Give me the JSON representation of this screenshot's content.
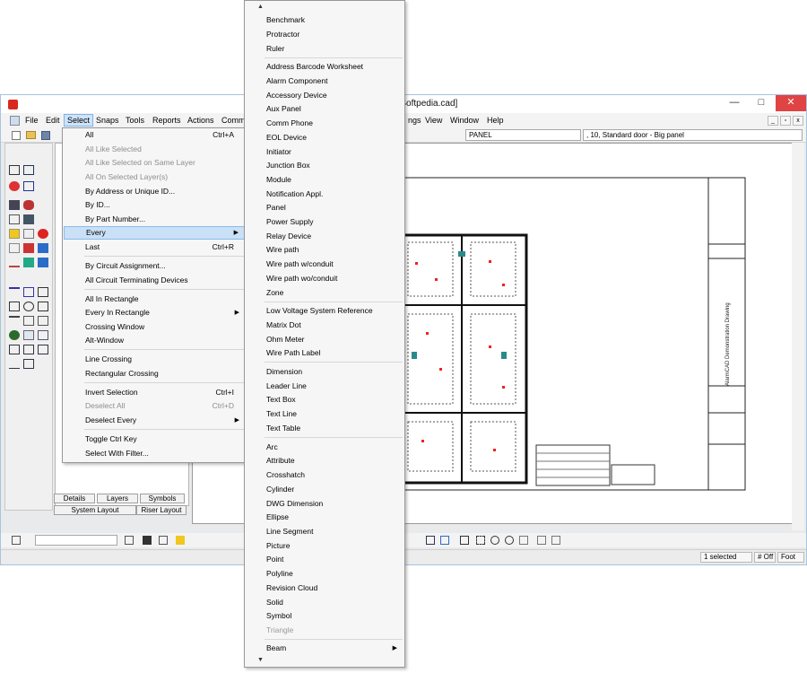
{
  "window": {
    "title": "c - [Softpedia.cad]",
    "minimize": "—",
    "maximize": "□",
    "close": "✕"
  },
  "menubar": {
    "file": "File",
    "edit": "Edit",
    "select": "Select",
    "snaps": "Snaps",
    "tools": "Tools",
    "reports": "Reports",
    "actions": "Actions",
    "comm": "Comm",
    "settings_partial": "ngs",
    "view": "View",
    "window": "Window",
    "help": "Help"
  },
  "toolbar": {
    "layer_combo": "PANEL",
    "block_combo": ", 10, Standard door - Big panel"
  },
  "left_panel": {
    "tabs": [
      "Details",
      "Layers",
      "Symbols"
    ],
    "bottom_tabs": [
      "System Layout",
      "Riser Layout"
    ]
  },
  "status": {
    "selected": "1 selected",
    "off": "# Off",
    "foot": "Foot"
  },
  "drawing": {
    "title_block_text": "AlarmCAD Demonstration Drawing"
  },
  "select_menu": {
    "items": [
      {
        "label": "All",
        "shortcut": "Ctrl+A",
        "disabled": false
      },
      {
        "label": "All Like Selected",
        "shortcut": "",
        "disabled": true
      },
      {
        "label": "All Like Selected on Same Layer",
        "shortcut": "",
        "disabled": true
      },
      {
        "label": "All On Selected Layer(s)",
        "shortcut": "",
        "disabled": true
      },
      {
        "label": "By Address or Unique ID...",
        "shortcut": "",
        "disabled": false
      },
      {
        "label": "By ID...",
        "shortcut": "",
        "disabled": false
      },
      {
        "label": "By Part Number...",
        "shortcut": "",
        "disabled": false
      },
      {
        "label": "Every",
        "shortcut": "",
        "disabled": false,
        "submenu": true
      },
      {
        "label": "Last",
        "shortcut": "Ctrl+R",
        "disabled": false
      },
      {
        "label": "By Circuit Assignment...",
        "shortcut": "",
        "disabled": false
      },
      {
        "label": "All Circuit Terminating Devices",
        "shortcut": "",
        "disabled": false
      },
      {
        "label": "All In Rectangle",
        "shortcut": "",
        "disabled": false
      },
      {
        "label": "Every In Rectangle",
        "shortcut": "",
        "disabled": false,
        "submenu": true
      },
      {
        "label": "Crossing Window",
        "shortcut": "",
        "disabled": false
      },
      {
        "label": "Alt-Window",
        "shortcut": "",
        "disabled": false
      },
      {
        "label": "Line Crossing",
        "shortcut": "",
        "disabled": false
      },
      {
        "label": "Rectangular Crossing",
        "shortcut": "",
        "disabled": false
      },
      {
        "label": "Invert Selection",
        "shortcut": "Ctrl+I",
        "disabled": false
      },
      {
        "label": "Deselect All",
        "shortcut": "Ctrl+D",
        "disabled": true
      },
      {
        "label": "Deselect Every",
        "shortcut": "",
        "disabled": false,
        "submenu": true
      },
      {
        "label": "Toggle Ctrl Key",
        "shortcut": "",
        "disabled": false
      },
      {
        "label": "Select With Filter...",
        "shortcut": "",
        "disabled": false
      }
    ]
  },
  "every_menu": {
    "items": [
      {
        "label": "Benchmark"
      },
      {
        "label": "Protractor"
      },
      {
        "label": "Ruler"
      },
      {
        "label": "Address Barcode Worksheet"
      },
      {
        "label": "Alarm Component"
      },
      {
        "label": "Accessory Device"
      },
      {
        "label": "Aux Panel"
      },
      {
        "label": "Comm Phone"
      },
      {
        "label": "EOL Device"
      },
      {
        "label": "Initiator"
      },
      {
        "label": "Junction Box"
      },
      {
        "label": "Module"
      },
      {
        "label": "Notification Appl."
      },
      {
        "label": "Panel"
      },
      {
        "label": "Power Supply"
      },
      {
        "label": "Relay Device"
      },
      {
        "label": "Wire path"
      },
      {
        "label": "Wire path w/conduit"
      },
      {
        "label": "Wire path wo/conduit"
      },
      {
        "label": "Zone"
      },
      {
        "label": "Low Voltage System Reference"
      },
      {
        "label": "Matrix Dot"
      },
      {
        "label": "Ohm Meter"
      },
      {
        "label": "Wire Path Label"
      },
      {
        "label": "Dimension"
      },
      {
        "label": "Leader Line"
      },
      {
        "label": "Text Box"
      },
      {
        "label": "Text Line"
      },
      {
        "label": "Text Table"
      },
      {
        "label": "Arc"
      },
      {
        "label": "Attribute"
      },
      {
        "label": "Crosshatch"
      },
      {
        "label": "Cylinder"
      },
      {
        "label": "DWG Dimension"
      },
      {
        "label": "Ellipse"
      },
      {
        "label": "Line Segment"
      },
      {
        "label": "Picture"
      },
      {
        "label": "Point"
      },
      {
        "label": "Polyline"
      },
      {
        "label": "Revision Cloud"
      },
      {
        "label": "Solid"
      },
      {
        "label": "Symbol"
      },
      {
        "label": "Triangle",
        "disabled": true
      },
      {
        "label": "Beam",
        "submenu": true
      }
    ],
    "scroll_up": "▲",
    "scroll_down": "▼"
  },
  "colors": {
    "highlight": "#c9e0f7",
    "close_button": "#e04343",
    "app_icon": "#d9281e"
  }
}
